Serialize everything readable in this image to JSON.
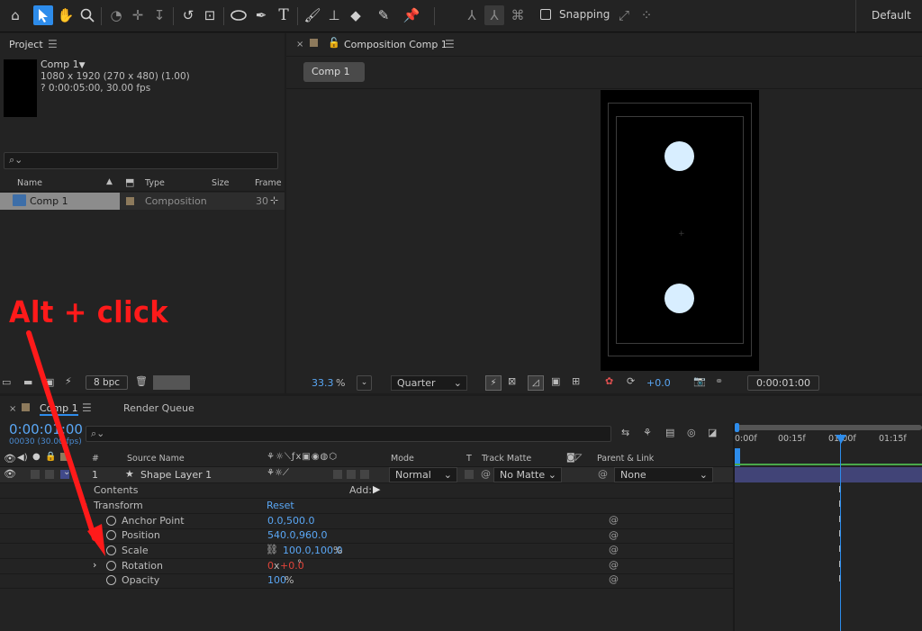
{
  "toolbar": {
    "tools": [
      "home-icon",
      "selection-icon",
      "hand-icon",
      "zoom-icon",
      "orbit-icon",
      "pan-behind-icon",
      "dolly-icon",
      "rotate-icon",
      "anchor-icon",
      "ellipse-icon",
      "pen-icon",
      "type-icon",
      "brush-icon",
      "clone-stamp-icon",
      "eraser-icon",
      "roto-brush-icon",
      "puppet-pin-icon"
    ],
    "snapping_label": "Snapping",
    "workspace": "Default"
  },
  "project": {
    "title": "Project",
    "item_name": "Comp 1",
    "item_dims": "1080 x 1920  (270 x 480) (1.00)",
    "item_duration": "? 0:00:05:00, 30.00 fps",
    "columns": [
      "Name",
      "Type",
      "Size",
      "Frame R"
    ],
    "rows": [
      {
        "name": "Comp 1",
        "type": "Composition",
        "frame": "30"
      }
    ],
    "bpc": "8 bpc"
  },
  "composition": {
    "title": "Composition Comp 1",
    "tab": "Comp 1",
    "zoom": "33.3",
    "zoom_unit": "%",
    "resolution": "Quarter",
    "exposure": "+0.0",
    "timecode": "0:00:01:00"
  },
  "timeline": {
    "tab": "Comp 1",
    "render_queue": "Render Queue",
    "current_time": "0:00:01:00",
    "frame_info": "00030 (30.00 fps)",
    "search_placeholder": "",
    "col_num": "#",
    "col_source": "Source Name",
    "col_mode": "Mode",
    "col_t": "T",
    "col_track": "Track Matte",
    "col_parent": "Parent & Link",
    "ruler": [
      "0:00f",
      "00:15f",
      "01:00f",
      "01:15f"
    ],
    "layer": {
      "num": "1",
      "name": "Shape Layer 1",
      "mode": "Normal",
      "matte": "No Matte",
      "parent": "None"
    },
    "contents_label": "Contents",
    "add_label": "Add:",
    "transform_label": "Transform",
    "reset_label": "Reset",
    "props": [
      {
        "name": "Anchor Point",
        "value": "0.0,500.0"
      },
      {
        "name": "Position",
        "value": "540.0,960.0"
      },
      {
        "name": "Scale",
        "value": "100.0,100.0",
        "unit": "%"
      },
      {
        "name": "Rotation",
        "value_a": "0",
        "value_b": "x",
        "value_c": "+0.0",
        "unit": "°"
      },
      {
        "name": "Opacity",
        "value": "100",
        "unit": "%"
      }
    ]
  },
  "annotation": {
    "text": "Alt + click",
    "color": "#ff1a1a"
  }
}
